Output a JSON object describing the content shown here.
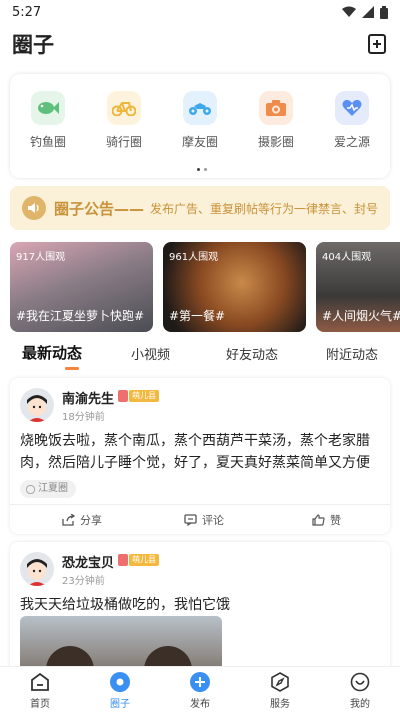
{
  "status_bar": {
    "time": "5:27"
  },
  "header": {
    "title": "圈子"
  },
  "categories": [
    {
      "label": "钓鱼圈",
      "icon": "fish-icon",
      "color": "#5fbf7d",
      "bg": "#e5f5ea"
    },
    {
      "label": "骑行圈",
      "icon": "bicycle-icon",
      "color": "#f0b63c",
      "bg": "#fdf3dd"
    },
    {
      "label": "摩友圈",
      "icon": "motorcycle-icon",
      "color": "#3ea7e8",
      "bg": "#e2f1fb"
    },
    {
      "label": "摄影圈",
      "icon": "camera-icon",
      "color": "#f08c4a",
      "bg": "#fdebe0"
    },
    {
      "label": "爱之源",
      "icon": "heart-icon",
      "color": "#5b8ff0",
      "bg": "#e4ecfc"
    }
  ],
  "notice": {
    "title": "圈子公告——",
    "text": "发布广告、重复刷帖等行为一律禁言、封号"
  },
  "topics": [
    {
      "views": "917人围观",
      "name": "#我在江夏坐萝卜快跑#"
    },
    {
      "views": "961人围观",
      "name": "#第一餐#"
    },
    {
      "views": "404人围观",
      "name": "#人间烟火气#"
    }
  ],
  "tabs": [
    "最新动态",
    "小视频",
    "好友动态",
    "附近动态"
  ],
  "posts": [
    {
      "author": "南渝先生",
      "time": "18分钟前",
      "badge": "萌儿县",
      "body": "烧晚饭去啦，蒸个南瓜，蒸个西葫芦干菜汤，蒸个老家腊肉，然后陪儿子睡个觉，好了，夏天真好蒸菜简单又方便",
      "tag": "江夏圈",
      "share": "分享",
      "comment": "评论",
      "like": "赞"
    },
    {
      "author": "恐龙宝贝",
      "time": "23分钟前",
      "badge": "萌儿县",
      "body": "我天天给垃圾桶做吃的，我怕它饿"
    }
  ],
  "bottom_nav": [
    {
      "label": "首页",
      "icon": "home-icon"
    },
    {
      "label": "圈子",
      "icon": "circle-icon"
    },
    {
      "label": "发布",
      "icon": "publish-icon"
    },
    {
      "label": "服务",
      "icon": "service-icon"
    },
    {
      "label": "我的",
      "icon": "profile-icon"
    }
  ],
  "colors": {
    "accent": "#3a8ff2",
    "tab_underline": "#f5813a",
    "notice_text": "#c8933a"
  }
}
